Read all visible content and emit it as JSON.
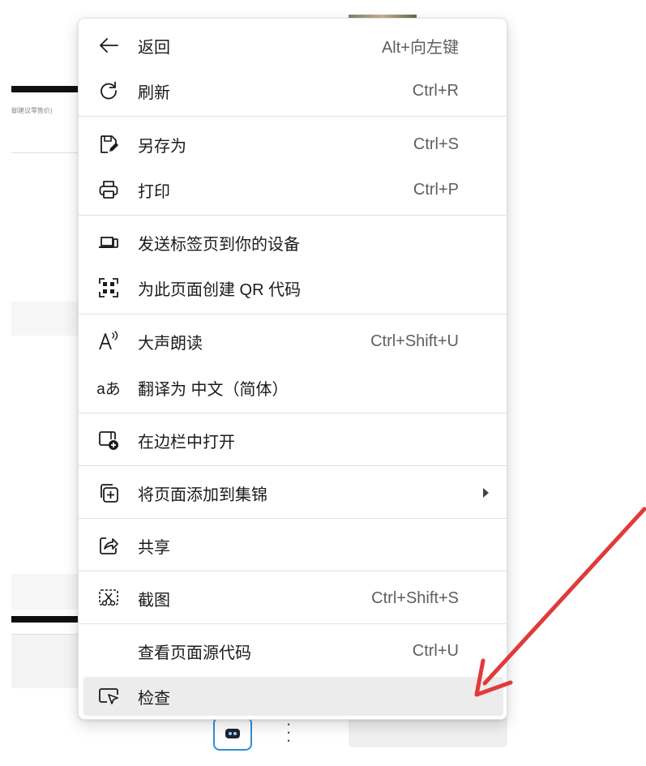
{
  "background": {
    "faint_text": "御建议零售价)"
  },
  "menu": {
    "items": [
      {
        "id": "back",
        "icon": "back-arrow-icon",
        "label": "返回",
        "shortcut": "Alt+向左键"
      },
      {
        "id": "refresh",
        "icon": "refresh-icon",
        "label": "刷新",
        "shortcut": "Ctrl+R"
      },
      {
        "id": "save-as",
        "icon": "save-as-icon",
        "label": "另存为",
        "shortcut": "Ctrl+S"
      },
      {
        "id": "print",
        "icon": "printer-icon",
        "label": "打印",
        "shortcut": "Ctrl+P"
      },
      {
        "id": "send-to-devices",
        "icon": "send-to-devices-icon",
        "label": "发送标签页到你的设备",
        "shortcut": ""
      },
      {
        "id": "qr-code",
        "icon": "qr-code-icon",
        "label": "为此页面创建 QR 代码",
        "shortcut": ""
      },
      {
        "id": "read-aloud",
        "icon": "read-aloud-icon",
        "label": "大声朗读",
        "shortcut": "Ctrl+Shift+U"
      },
      {
        "id": "translate",
        "icon": "translate-icon",
        "label": "翻译为 中文（简体）",
        "shortcut": ""
      },
      {
        "id": "open-in-sidebar",
        "icon": "sidebar-add-icon",
        "label": "在边栏中打开",
        "shortcut": ""
      },
      {
        "id": "add-to-collections",
        "icon": "collections-add-icon",
        "label": "将页面添加到集锦",
        "shortcut": "",
        "submenu": true
      },
      {
        "id": "share",
        "icon": "share-icon",
        "label": "共享",
        "shortcut": ""
      },
      {
        "id": "screenshot",
        "icon": "screenshot-icon",
        "label": "截图",
        "shortcut": "Ctrl+Shift+S"
      },
      {
        "id": "view-source",
        "icon": "",
        "label": "查看页面源代码",
        "shortcut": "Ctrl+U"
      },
      {
        "id": "inspect",
        "icon": "inspect-icon",
        "label": "检查",
        "shortcut": ""
      }
    ]
  },
  "annotation": {
    "color": "#e03a3a",
    "icon": "red-arrow-pointer"
  },
  "colors": {
    "menu_bg": "#ffffff",
    "hover_bg": "#ececec",
    "separator": "#e1e1e1",
    "text": "#1b1b1b",
    "shortcut_text": "#5f5f5f"
  }
}
